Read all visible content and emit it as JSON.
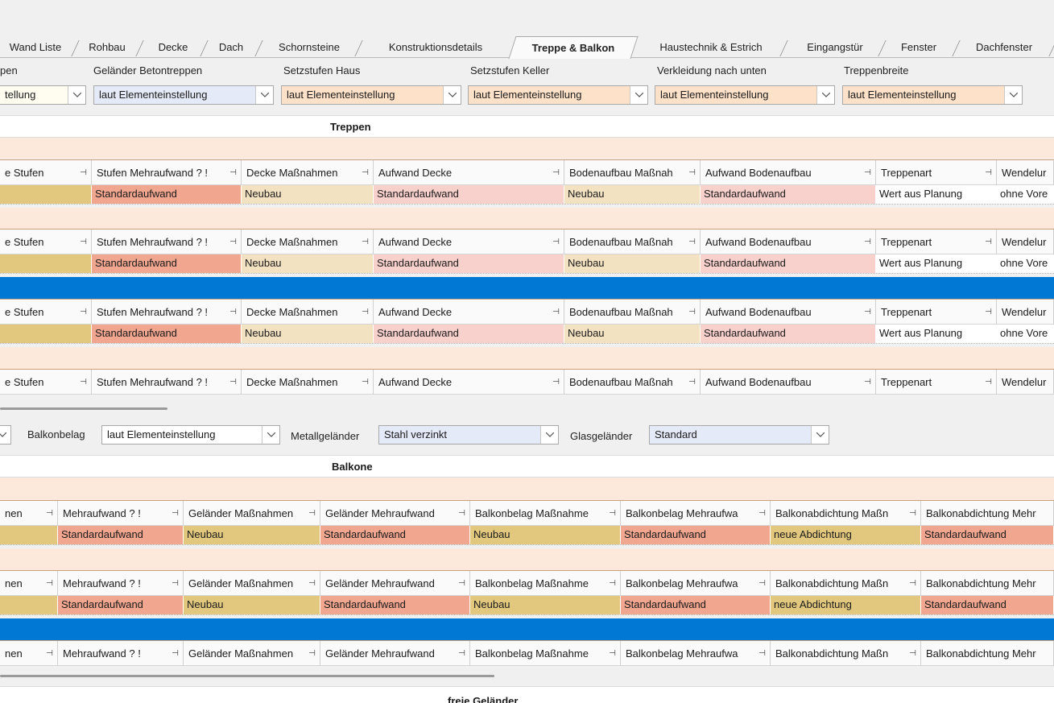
{
  "tabs": [
    {
      "label": "Wand Liste"
    },
    {
      "label": "Rohbau"
    },
    {
      "label": "Decke"
    },
    {
      "label": "Dach"
    },
    {
      "label": "Schornsteine"
    },
    {
      "label": "Konstruktionsdetails"
    },
    {
      "label": "Treppe & Balkon"
    },
    {
      "label": "Haustechnik & Estrich"
    },
    {
      "label": "Eingangstür"
    },
    {
      "label": "Fenster"
    },
    {
      "label": "Dachfenster"
    }
  ],
  "stair_filters": [
    {
      "label": "pen",
      "value": "tellung"
    },
    {
      "label": "Geländer Betontreppen",
      "value": "laut Elementeinstellung"
    },
    {
      "label": "Setzstufen Haus",
      "value": "laut Elementeinstellung"
    },
    {
      "label": "Setzstufen Keller",
      "value": "laut Elementeinstellung"
    },
    {
      "label": "Verkleidung nach unten",
      "value": "laut Elementeinstellung"
    },
    {
      "label": "Treppenbreite",
      "value": "laut Elementeinstellung"
    }
  ],
  "treppen": {
    "title": "Treppen",
    "headers": [
      "e Stufen",
      "Stufen Mehraufwand ? !",
      "Decke Maßnahmen",
      "Aufwand Decke",
      "Bodenaufbau Maßnah",
      "Aufwand Bodenaufbau",
      "Treppenart",
      "Wendelur"
    ],
    "row": [
      "",
      "Standardaufwand",
      "Neubau",
      "Standardaufwand",
      "Neubau",
      "Standardaufwand",
      "Wert aus Planung",
      "ohne Vore"
    ]
  },
  "balkon_filters": {
    "balkonbelag_label": "Balkonbelag",
    "balkonbelag_value": "laut Elementeinstellung",
    "metall_label": "Metallgeländer",
    "metall_value": "Stahl verzinkt",
    "glas_label": "Glasgeländer",
    "glas_value": "Standard"
  },
  "balkone": {
    "title": "Balkone",
    "headers": [
      "nen",
      "Mehraufwand ? !",
      "Geländer Maßnahmen",
      "Geländer Mehraufwand",
      "Balkonbelag Maßnahme",
      "Balkonbelag Mehraufwa",
      "Balkonabdichtung Maßn",
      "Balkonabdichtung Mehr"
    ],
    "row": [
      "",
      "Standardaufwand",
      "Neubau",
      "Standardaufwand",
      "Neubau",
      "Standardaufwand",
      "neue Abdichtung",
      "Standardaufwand"
    ]
  },
  "freie_gelaender": {
    "title": "freie Geländer"
  },
  "pin_glyph": "⊣",
  "colors": {
    "selection_blue": "#0078d4",
    "peach": "#fde9dc"
  }
}
